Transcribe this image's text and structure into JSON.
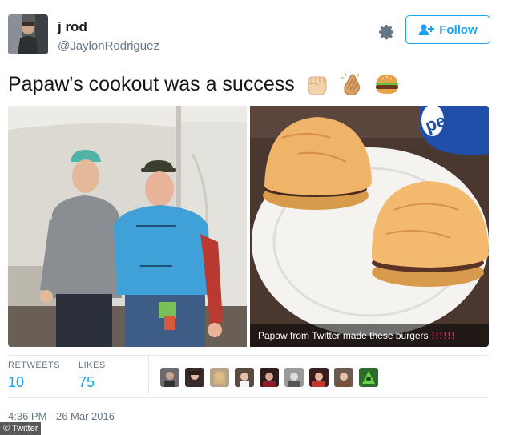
{
  "tweet": {
    "name": "j rod",
    "handle": "@JaylonRodriguez",
    "follow_label": "Follow",
    "text": "Papaw's cookout was a success",
    "emojis": [
      "fist-emoji",
      "clapping-hands-emoji",
      "hamburger-emoji"
    ],
    "photo_caption": "Papaw from Twitter made these burgers",
    "photo_caption_bangs": "!!!!!!",
    "stats": {
      "retweets_label": "RETWEETS",
      "retweets": "10",
      "likes_label": "LIKES",
      "likes": "75"
    },
    "liker_avatars": [
      "liker-1",
      "liker-2",
      "liker-3",
      "liker-4",
      "liker-5",
      "liker-6",
      "liker-7",
      "liker-8",
      "liker-9"
    ],
    "timestamp": "4:36 PM - 26 Mar 2016"
  },
  "watermark": "© Twitter",
  "colors": {
    "accent": "#1da1f2",
    "text": "#14171a",
    "secondary": "#657786",
    "border": "#e1e8ed"
  }
}
